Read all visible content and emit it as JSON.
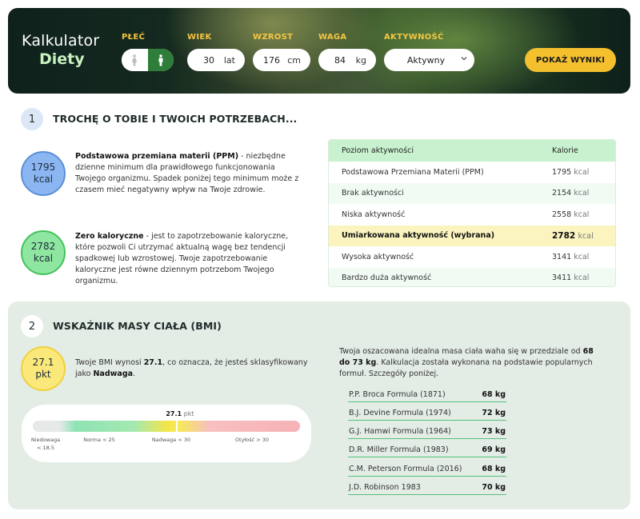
{
  "header": {
    "logo_line1": "Kalkulator",
    "logo_line2": "Diety",
    "labels": {
      "gender": "PŁEĆ",
      "age": "WIEK",
      "height": "WZROST",
      "weight": "WAGA",
      "activity": "AKTYWNOŚĆ"
    },
    "gender_selected": "male",
    "age": {
      "value": "30",
      "unit": "lat"
    },
    "height": {
      "value": "176",
      "unit": "cm"
    },
    "weight": {
      "value": "84",
      "unit": "kg"
    },
    "activity_selected": "Aktywny",
    "show_button": "POKAŻ WYNIKI"
  },
  "section1": {
    "step": "1",
    "title": "TROCHĘ O TOBIE I TWOICH POTRZEBACH...",
    "ppm": {
      "value": "1795",
      "unit": "kcal",
      "term": "Podstawowa przemiana materii (PPM)",
      "text": " - niezbędne dzienne minimum dla prawidłowego funkcjonowania Twojego organizmu. Spadek poniżej tego minimum może z czasem mieć negatywny wpływ na Twoje zdrowie."
    },
    "zero": {
      "value": "2782",
      "unit": "kcal",
      "term": "Zero kaloryczne",
      "text": " - jest to zapotrzebowanie kaloryczne, które pozwoli Ci utrzymać aktualną wagę bez tendencji spadkowej lub wzrostowej. Twoje zapotrzebowanie kaloryczne jest równe dziennym potrzebom Twojego organizmu."
    },
    "table": {
      "headers": [
        "Poziom aktywności",
        "Kalorie"
      ],
      "unit": "kcal",
      "rows": [
        {
          "label": "Podstawowa Przemiana Materii (PPM)",
          "value": "1795"
        },
        {
          "label": "Brak aktywności",
          "value": "2154"
        },
        {
          "label": "Niska aktywność",
          "value": "2558"
        },
        {
          "label": "Umiarkowana aktywność (wybrana)",
          "value": "2782"
        },
        {
          "label": "Wysoka aktywność",
          "value": "3141"
        },
        {
          "label": "Bardzo duża aktywność",
          "value": "3411"
        }
      ]
    }
  },
  "section2": {
    "step": "2",
    "title": "WSKAŹNIK MASY CIAŁA (BMI)",
    "bmi": {
      "value": "27.1",
      "unit": "pkt"
    },
    "bmi_text_1": "Twoje BMI wynosi ",
    "bmi_text_value": "27.1",
    "bmi_text_2": ", co oznacza, że jesteś sklasyfikowany jako ",
    "bmi_text_class": "Nadwaga",
    "bmi_text_3": ".",
    "scale": {
      "marker_value": "27.1",
      "marker_unit": "pkt",
      "marker_fraction": 0.54,
      "labels": [
        "Niedowaga < 18.5",
        "Norma < 25",
        "Nadwaga < 30",
        "Otyłość > 30"
      ]
    },
    "ideal_text_1": "Twoja oszacowana idealna masa ciała waha się w przedziale od ",
    "ideal_min": "68 do 73 kg",
    "ideal_text_2": ". Kalkulacja została wykonana na podstawie popularnych formuł. Szczegóły poniżej.",
    "formulas": [
      {
        "name": "P.P. Broca Formula (1871)",
        "value": "68 kg"
      },
      {
        "name": "B.J. Devine Formula (1974)",
        "value": "72 kg"
      },
      {
        "name": "G.J. Hamwi Formula (1964)",
        "value": "73 kg"
      },
      {
        "name": "D.R. Miller Formula (1983)",
        "value": "69 kg"
      },
      {
        "name": "C.M. Peterson Formula (2016)",
        "value": "68 kg"
      },
      {
        "name": "J.D. Robinson 1983",
        "value": "70 kg"
      }
    ]
  }
}
